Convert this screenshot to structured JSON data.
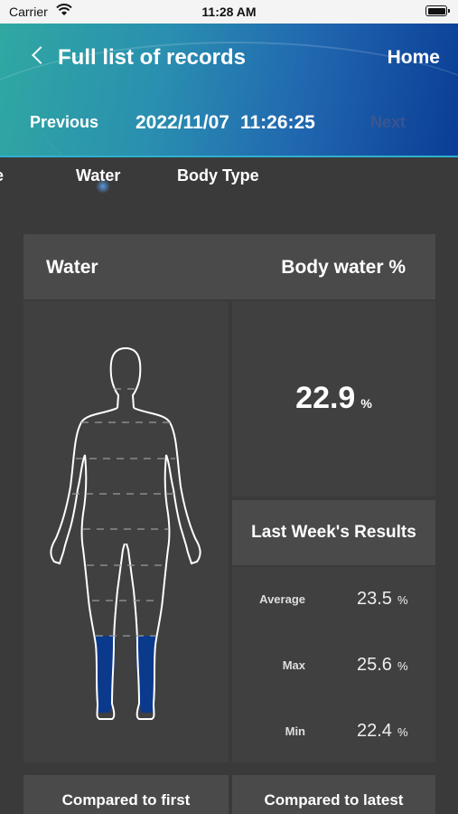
{
  "status_bar": {
    "carrier": "Carrier",
    "time": "11:28 AM"
  },
  "header": {
    "title": "Full list of records",
    "home": "Home",
    "previous": "Previous",
    "date": "2022/11/07",
    "time": "11:26:25",
    "next": "Next"
  },
  "tabs": {
    "partial": "e",
    "water": "Water",
    "body_type": "Body Type"
  },
  "card": {
    "title": "Water",
    "metric": "Body water %"
  },
  "current": {
    "value": "22.9",
    "unit": "%"
  },
  "last_week": {
    "title": "Last Week's Results",
    "average_label": "Average",
    "average": "23.5",
    "max_label": "Max",
    "max": "25.6",
    "min_label": "Min",
    "min": "22.4",
    "unit": "%"
  },
  "compare": {
    "first": "Compared to first",
    "latest": "Compared to latest"
  },
  "colors": {
    "header_start": "#2fa8a2",
    "header_end": "#0b3d96",
    "level_fill": "#0b3a8c"
  },
  "body_fill_level": 0.15
}
